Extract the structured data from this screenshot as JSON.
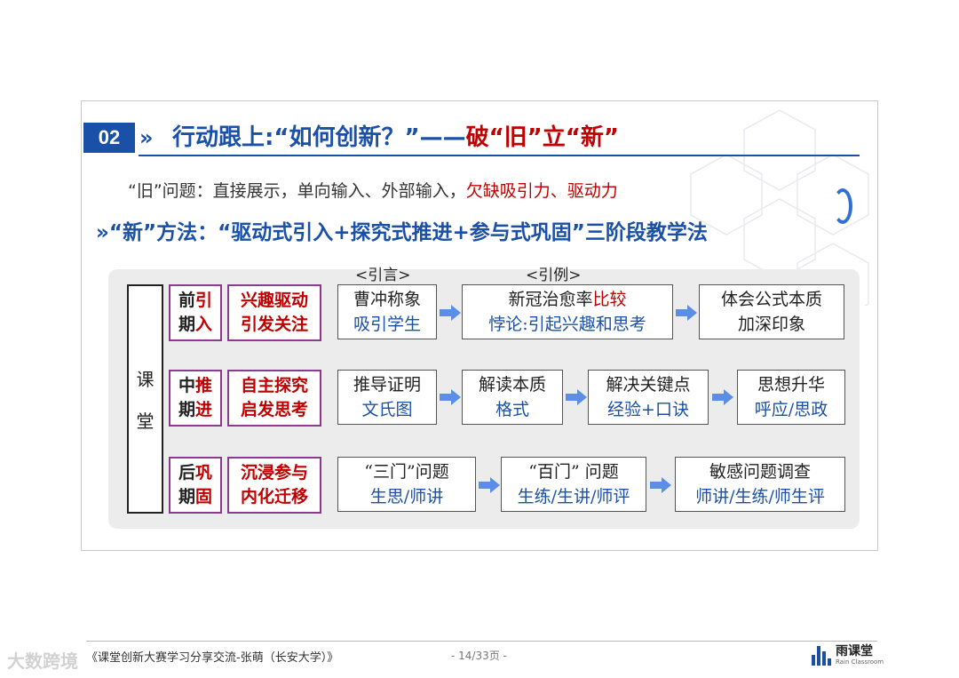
{
  "slide": {
    "section_number": "02",
    "title_chevron": "»",
    "title_part1": "行动跟上:“如何创新？”——",
    "title_part2": "破“旧”立“新”",
    "old_prefix": "“旧”问题：直接展示，单向输入、外部输入，",
    "old_highlight": "欠缺吸引力、驱动力",
    "new_line": "»“新”方法：“驱动式引入+探究式推进+参与式巩固”三阶段教学法"
  },
  "diagram": {
    "classroom_label_1": "课",
    "classroom_label_2": "堂",
    "label_intro": "<引言>",
    "label_example": "<引例>",
    "rows": [
      {
        "phase_a": "前",
        "phase_b": "引",
        "phase_c": "期",
        "phase_d": "入",
        "goal_1": "兴趣驱动",
        "goal_2": "引发关注",
        "steps": [
          {
            "main": "曹冲称象",
            "sub": "吸引学生"
          },
          {
            "main": "新冠治愈率",
            "main_red": "比较",
            "sub": "悖论:引起兴趣和思考"
          },
          {
            "main": "体会公式本质",
            "sub": "加深印象"
          }
        ]
      },
      {
        "phase_a": "中",
        "phase_b": "推",
        "phase_c": "期",
        "phase_d": "进",
        "goal_1": "自主探究",
        "goal_2": "启发思考",
        "steps": [
          {
            "main": "推导证明",
            "sub": "文氏图"
          },
          {
            "main": "解读本质",
            "sub": "格式"
          },
          {
            "main": "解决关键点",
            "sub": "经验+口诀"
          },
          {
            "main": "思想升华",
            "sub": "呼应/思政"
          }
        ]
      },
      {
        "phase_a": "后",
        "phase_b": "巩",
        "phase_c": "期",
        "phase_d": "固",
        "goal_1": "沉浸参与",
        "goal_2": "内化迁移",
        "steps": [
          {
            "main": "“三门”问题",
            "sub": "生思/师讲"
          },
          {
            "main": "“百门” 问题",
            "sub": "生练/生讲/师评"
          },
          {
            "main": "敏感问题调查",
            "sub": "师讲/生练/师生评"
          }
        ]
      }
    ]
  },
  "footer": {
    "text": "《课堂创新大赛学习分享交流-张萌（长安大学）》",
    "page": "- 14/33页 -",
    "logo_title": "雨课堂",
    "logo_sub": "Rain Classroom",
    "watermark": "大数跨境"
  },
  "colors": {
    "accent_blue": "#1a50a8",
    "accent_red": "#c00000",
    "phase_border": "#8b3a8f",
    "arrow_blue": "#5b8ee6"
  }
}
